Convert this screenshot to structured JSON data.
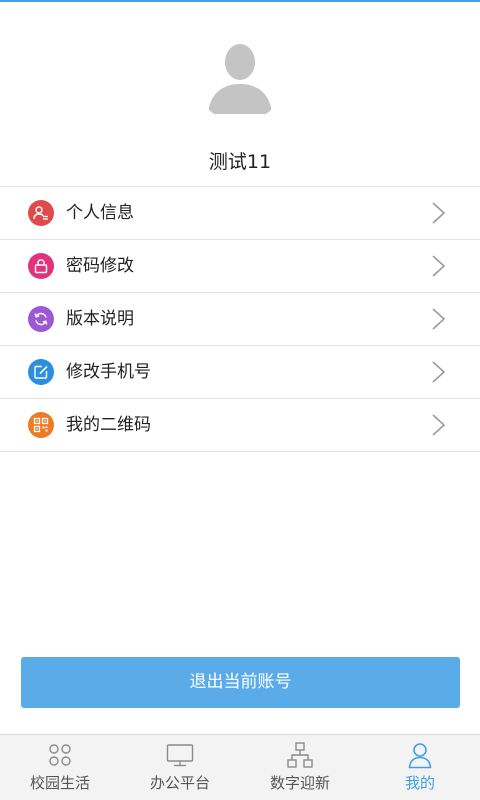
{
  "profile": {
    "username": "测试11"
  },
  "menu": {
    "items": [
      {
        "label": "个人信息",
        "icon": "person-card-icon",
        "color": "#e04a4a"
      },
      {
        "label": "密码修改",
        "icon": "lock-icon",
        "color": "#e0337a"
      },
      {
        "label": "版本说明",
        "icon": "refresh-icon",
        "color": "#9b59d6"
      },
      {
        "label": "修改手机号",
        "icon": "edit-icon",
        "color": "#2a8fde"
      },
      {
        "label": "我的二维码",
        "icon": "qrcode-icon",
        "color": "#ee7a25"
      }
    ]
  },
  "logout": {
    "label": "退出当前账号",
    "color": "#5aace8"
  },
  "tabbar": {
    "tabs": [
      {
        "label": "校园生活",
        "icon": "campus-life-icon",
        "active": false
      },
      {
        "label": "办公平台",
        "icon": "monitor-icon",
        "active": false
      },
      {
        "label": "数字迎新",
        "icon": "org-chart-icon",
        "active": false
      },
      {
        "label": "我的",
        "icon": "person-icon",
        "active": true
      }
    ],
    "active_color": "#3fa0e6",
    "inactive_color": "#555555"
  }
}
